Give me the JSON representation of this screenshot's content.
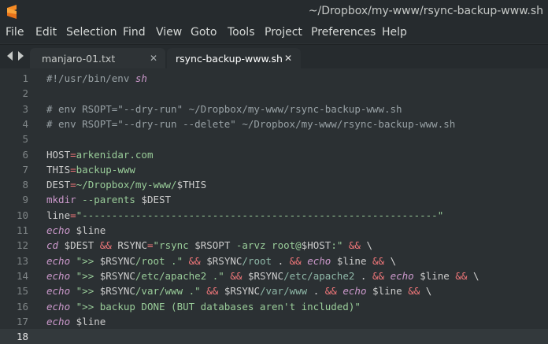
{
  "window": {
    "title": "~/Dropbox/my-www/rsync-backup-www.sh"
  },
  "menu": [
    "File",
    "Edit",
    "Selection",
    "Find",
    "View",
    "Goto",
    "Tools",
    "Project",
    "Preferences",
    "Help"
  ],
  "tabs": [
    {
      "label": "manjaro-01.txt",
      "close": "✕"
    },
    {
      "label": "rsync-backup-www.sh",
      "close": "✕"
    }
  ],
  "editor": {
    "lines": [
      {
        "n": "1",
        "tokens": [
          {
            "t": "#!/usr/bin/env ",
            "c": "comment"
          },
          {
            "t": "sh",
            "c": "kw"
          }
        ]
      },
      {
        "n": "2",
        "tokens": []
      },
      {
        "n": "3",
        "tokens": [
          {
            "t": "# env RSOPT=\"--dry-run\" ~/Dropbox/my-www/rsync-backup-www.sh",
            "c": "comment"
          }
        ]
      },
      {
        "n": "4",
        "tokens": [
          {
            "t": "# env RSOPT=\"--dry-run --delete\" ~/Dropbox/my-www/rsync-backup-www.sh",
            "c": "comment"
          }
        ]
      },
      {
        "n": "5",
        "tokens": []
      },
      {
        "n": "6",
        "tokens": [
          {
            "t": "HOST",
            "c": "var"
          },
          {
            "t": "=",
            "c": "op"
          },
          {
            "t": "arkenidar.com",
            "c": "str"
          }
        ]
      },
      {
        "n": "7",
        "tokens": [
          {
            "t": "THIS",
            "c": "var"
          },
          {
            "t": "=",
            "c": "op"
          },
          {
            "t": "backup-www",
            "c": "str"
          }
        ]
      },
      {
        "n": "8",
        "tokens": [
          {
            "t": "DEST",
            "c": "var"
          },
          {
            "t": "=",
            "c": "op"
          },
          {
            "t": "~/Dropbox/my-www/",
            "c": "str"
          },
          {
            "t": "$THIS",
            "c": "var"
          }
        ]
      },
      {
        "n": "9",
        "tokens": [
          {
            "t": "mkdir",
            "c": "cmd"
          },
          {
            "t": " --parents ",
            "c": "str"
          },
          {
            "t": "$DEST",
            "c": "var"
          }
        ]
      },
      {
        "n": "10",
        "tokens": [
          {
            "t": "line",
            "c": "var"
          },
          {
            "t": "=",
            "c": "op"
          },
          {
            "t": "\"------------------------------------------------------------\"",
            "c": "str"
          }
        ]
      },
      {
        "n": "11",
        "tokens": [
          {
            "t": "echo",
            "c": "kw"
          },
          {
            "t": " ",
            "c": "plain"
          },
          {
            "t": "$line",
            "c": "var"
          }
        ]
      },
      {
        "n": "12",
        "tokens": [
          {
            "t": "cd",
            "c": "kw"
          },
          {
            "t": " ",
            "c": "plain"
          },
          {
            "t": "$DEST",
            "c": "var"
          },
          {
            "t": " ",
            "c": "plain"
          },
          {
            "t": "&&",
            "c": "op"
          },
          {
            "t": " RSYNC",
            "c": "var"
          },
          {
            "t": "=",
            "c": "op"
          },
          {
            "t": "\"rsync ",
            "c": "str"
          },
          {
            "t": "$RSOPT",
            "c": "var"
          },
          {
            "t": " -arvz root@",
            "c": "str"
          },
          {
            "t": "$HOST",
            "c": "var"
          },
          {
            "t": ":\"",
            "c": "str"
          },
          {
            "t": " ",
            "c": "plain"
          },
          {
            "t": "&&",
            "c": "op"
          },
          {
            "t": " \\",
            "c": "plain"
          }
        ]
      },
      {
        "n": "13",
        "tokens": [
          {
            "t": "echo",
            "c": "kw"
          },
          {
            "t": " ",
            "c": "plain"
          },
          {
            "t": "\">> ",
            "c": "str"
          },
          {
            "t": "$RSYNC",
            "c": "var"
          },
          {
            "t": "/root .\"",
            "c": "str"
          },
          {
            "t": " ",
            "c": "plain"
          },
          {
            "t": "&&",
            "c": "op"
          },
          {
            "t": " ",
            "c": "plain"
          },
          {
            "t": "$RSYNC",
            "c": "var"
          },
          {
            "t": "/root",
            "c": "path"
          },
          {
            "t": " . ",
            "c": "plain"
          },
          {
            "t": "&&",
            "c": "op"
          },
          {
            "t": " ",
            "c": "plain"
          },
          {
            "t": "echo",
            "c": "kw"
          },
          {
            "t": " ",
            "c": "plain"
          },
          {
            "t": "$line",
            "c": "var"
          },
          {
            "t": " ",
            "c": "plain"
          },
          {
            "t": "&&",
            "c": "op"
          },
          {
            "t": " \\",
            "c": "plain"
          }
        ]
      },
      {
        "n": "14",
        "tokens": [
          {
            "t": "echo",
            "c": "kw"
          },
          {
            "t": " ",
            "c": "plain"
          },
          {
            "t": "\">> ",
            "c": "str"
          },
          {
            "t": "$RSYNC",
            "c": "var"
          },
          {
            "t": "/etc/apache2 .\"",
            "c": "str"
          },
          {
            "t": " ",
            "c": "plain"
          },
          {
            "t": "&&",
            "c": "op"
          },
          {
            "t": " ",
            "c": "plain"
          },
          {
            "t": "$RSYNC",
            "c": "var"
          },
          {
            "t": "/etc/apache2",
            "c": "path"
          },
          {
            "t": " . ",
            "c": "plain"
          },
          {
            "t": "&&",
            "c": "op"
          },
          {
            "t": " ",
            "c": "plain"
          },
          {
            "t": "echo",
            "c": "kw"
          },
          {
            "t": " ",
            "c": "plain"
          },
          {
            "t": "$line",
            "c": "var"
          },
          {
            "t": " ",
            "c": "plain"
          },
          {
            "t": "&&",
            "c": "op"
          },
          {
            "t": " \\",
            "c": "plain"
          }
        ]
      },
      {
        "n": "15",
        "tokens": [
          {
            "t": "echo",
            "c": "kw"
          },
          {
            "t": " ",
            "c": "plain"
          },
          {
            "t": "\">> ",
            "c": "str"
          },
          {
            "t": "$RSYNC",
            "c": "var"
          },
          {
            "t": "/var/www .\"",
            "c": "str"
          },
          {
            "t": " ",
            "c": "plain"
          },
          {
            "t": "&&",
            "c": "op"
          },
          {
            "t": " ",
            "c": "plain"
          },
          {
            "t": "$RSYNC",
            "c": "var"
          },
          {
            "t": "/var/www",
            "c": "path"
          },
          {
            "t": " . ",
            "c": "plain"
          },
          {
            "t": "&&",
            "c": "op"
          },
          {
            "t": " ",
            "c": "plain"
          },
          {
            "t": "echo",
            "c": "kw"
          },
          {
            "t": " ",
            "c": "plain"
          },
          {
            "t": "$line",
            "c": "var"
          },
          {
            "t": " ",
            "c": "plain"
          },
          {
            "t": "&&",
            "c": "op"
          },
          {
            "t": " \\",
            "c": "plain"
          }
        ]
      },
      {
        "n": "16",
        "tokens": [
          {
            "t": "echo",
            "c": "kw"
          },
          {
            "t": " ",
            "c": "plain"
          },
          {
            "t": "\">> backup DONE (BUT databases aren't included)\"",
            "c": "str"
          }
        ]
      },
      {
        "n": "17",
        "tokens": [
          {
            "t": "echo",
            "c": "kw"
          },
          {
            "t": " ",
            "c": "plain"
          },
          {
            "t": "$line",
            "c": "var"
          }
        ]
      },
      {
        "n": "18",
        "tokens": []
      }
    ],
    "current_line": "18"
  },
  "colors": {
    "background": "#2b3033",
    "chrome": "#262b2e",
    "accent": "#f2777a"
  },
  "icons": {
    "app": "sublime-text-icon",
    "nav_left": "arrow-left-icon",
    "nav_right": "arrow-right-icon"
  }
}
